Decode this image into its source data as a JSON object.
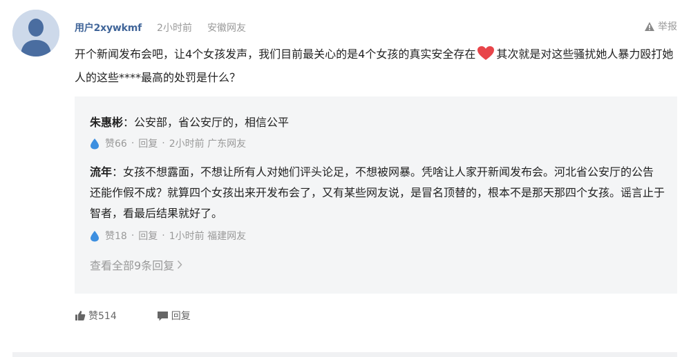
{
  "comment": {
    "username": "用户2xywkmf",
    "time": "2小时前",
    "location": "安徽网友",
    "report_label": "举报",
    "text_before_heart": "开个新闻发布会吧，让4个女孩发声，我们目前最关心的是4个女孩的真实安全存在",
    "text_after_heart": "其次就是对这些骚扰她人暴力殴打她人的这些****最高的处罚是什么？",
    "likes_label": "赞514",
    "reply_label": "回复"
  },
  "replies": [
    {
      "name": "朱惠彬",
      "separator": "：",
      "text": "公安部，省公安厅的，相信公平",
      "likes": "赞66",
      "dot1": "·",
      "reply_label": "回复",
      "dot2": "·",
      "time_location": "2小时前 广东网友"
    },
    {
      "name": "流年",
      "separator": "：",
      "text": "女孩不想露面，不想让所有人对她们评头论足，不想被网暴。凭啥让人家开新闻发布会。河北省公安厅的公告还能作假不成？就算四个女孩出来开发布会了，又有某些网友说，是冒名顶替的，根本不是那天那四个女孩。谣言止于智者，看最后结果就好了。",
      "likes": "赞18",
      "dot1": "·",
      "reply_label": "回复",
      "dot2": "·",
      "time_location": "1小时前 福建网友"
    }
  ],
  "view_all_label": "查看全部9条回复",
  "colors": {
    "username": "#406599",
    "meta_gray": "#999999",
    "reply_bg": "#f4f5f6",
    "drop_blue": "#3d8fe0",
    "heart_red": "#e8454a"
  },
  "icons": {
    "avatar": "default-user-avatar",
    "report": "warning-triangle-icon",
    "heart": "heart-emoji",
    "reply_like": "water-drop-icon",
    "thumb": "thumbs-up-icon",
    "reply": "speech-bubble-icon",
    "chevron": "chevron-right-icon"
  }
}
